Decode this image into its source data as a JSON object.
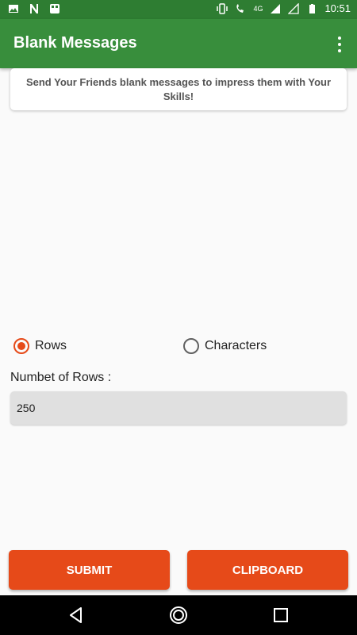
{
  "status_bar": {
    "time": "10:51",
    "network_label": "4G",
    "left_icons": [
      "image-icon",
      "n-app-icon",
      "grid-app-icon"
    ],
    "right_icons": [
      "vibrate-icon",
      "wifi-calling-icon",
      "signal-icon",
      "signal-icon",
      "battery-icon"
    ]
  },
  "app_bar": {
    "title": "Blank Messages",
    "menu_icon": "overflow-menu-icon"
  },
  "info_card": {
    "text": "Send Your Friends blank messages to impress them with Your Skills!"
  },
  "mode": {
    "options": [
      {
        "label": "Rows",
        "checked": true
      },
      {
        "label": "Characters",
        "checked": false
      }
    ]
  },
  "rows_field": {
    "label": "Numbet of Rows :",
    "value": "250"
  },
  "buttons": {
    "submit": "SUBMIT",
    "clipboard": "CLIPBOARD"
  },
  "colors": {
    "status_bar": "#2e7d32",
    "app_bar": "#388e3c",
    "accent": "#e64a19"
  },
  "nav_bar": {
    "icons": [
      "back-icon",
      "home-icon",
      "recents-icon"
    ]
  }
}
